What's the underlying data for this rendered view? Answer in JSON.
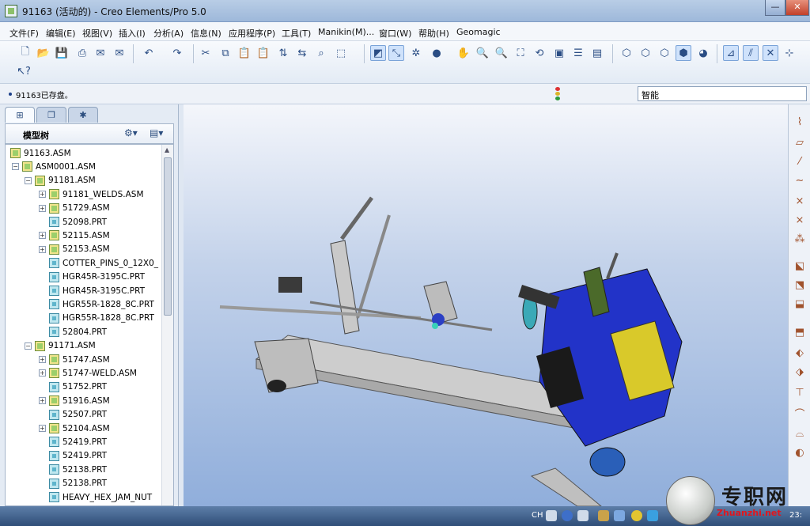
{
  "window": {
    "title": "91163 (活动的) - Creo Elements/Pro 5.0",
    "minimize_glyph": "—",
    "close_glyph": "✕"
  },
  "menu": [
    "文件(F)",
    "编辑(E)",
    "视图(V)",
    "插入(I)",
    "分析(A)",
    "信息(N)",
    "应用程序(P)",
    "工具(T)",
    "Manikin(M)...",
    "窗口(W)",
    "帮助(H)",
    "Geomagic"
  ],
  "message_line": {
    "text": "91163已存盘。",
    "filter_value": "智能"
  },
  "panel": {
    "tabs": [
      "model-tree-tab",
      "layer-tab",
      "favorites-tab"
    ],
    "header_label": "模型树"
  },
  "tree": [
    {
      "name": "91163.ASM",
      "type": "asm",
      "level": 0,
      "toggle": ""
    },
    {
      "name": "ASM0001.ASM",
      "type": "asm",
      "level": 1,
      "toggle": "−"
    },
    {
      "name": "91181.ASM",
      "type": "asm",
      "level": 2,
      "toggle": "−"
    },
    {
      "name": "91181_WELDS.ASM",
      "type": "asm",
      "level": 3,
      "toggle": "+"
    },
    {
      "name": "51729.ASM",
      "type": "asm",
      "level": 3,
      "toggle": "+"
    },
    {
      "name": "52098.PRT",
      "type": "prt",
      "level": 3,
      "toggle": ""
    },
    {
      "name": "52115.ASM",
      "type": "asm",
      "level": 3,
      "toggle": "+"
    },
    {
      "name": "52153.ASM",
      "type": "asm",
      "level": 3,
      "toggle": "+"
    },
    {
      "name": "COTTER_PINS_0_12X0_",
      "type": "prt",
      "level": 3,
      "toggle": ""
    },
    {
      "name": "HGR45R-3195C.PRT",
      "type": "prt",
      "level": 3,
      "toggle": ""
    },
    {
      "name": "HGR45R-3195C.PRT",
      "type": "prt",
      "level": 3,
      "toggle": ""
    },
    {
      "name": "HGR55R-1828_8C.PRT",
      "type": "prt",
      "level": 3,
      "toggle": ""
    },
    {
      "name": "HGR55R-1828_8C.PRT",
      "type": "prt",
      "level": 3,
      "toggle": ""
    },
    {
      "name": "52804.PRT",
      "type": "prt",
      "level": 3,
      "toggle": ""
    },
    {
      "name": "91171.ASM",
      "type": "asm",
      "level": 2,
      "toggle": "−"
    },
    {
      "name": "51747.ASM",
      "type": "asm",
      "level": 3,
      "toggle": "+"
    },
    {
      "name": "51747-WELD.ASM",
      "type": "asm",
      "level": 3,
      "toggle": "+"
    },
    {
      "name": "51752.PRT",
      "type": "prt",
      "level": 3,
      "toggle": ""
    },
    {
      "name": "51916.ASM",
      "type": "asm",
      "level": 3,
      "toggle": "+"
    },
    {
      "name": "52507.PRT",
      "type": "prt",
      "level": 3,
      "toggle": ""
    },
    {
      "name": "52104.ASM",
      "type": "asm",
      "level": 3,
      "toggle": "+"
    },
    {
      "name": "52419.PRT",
      "type": "prt",
      "level": 3,
      "toggle": ""
    },
    {
      "name": "52419.PRT",
      "type": "prt",
      "level": 3,
      "toggle": ""
    },
    {
      "name": "52138.PRT",
      "type": "prt",
      "level": 3,
      "toggle": ""
    },
    {
      "name": "52138.PRT",
      "type": "prt",
      "level": 3,
      "toggle": ""
    },
    {
      "name": "HEAVY_HEX_JAM_NUT",
      "type": "prt",
      "level": 3,
      "toggle": ""
    }
  ],
  "taskbar": {
    "lang": "CH",
    "clock": "23:"
  },
  "watermark": {
    "text": "专职网",
    "url": "Zhuanzhi.net"
  },
  "colors": {
    "accent": "#7aa3d8",
    "graphics_top": "#f4f6fb",
    "graphics_bottom": "#90aedb",
    "model_blue": "#2b3fc4",
    "model_gray": "#cfcfcf",
    "model_yellow": "#d9c92a"
  }
}
